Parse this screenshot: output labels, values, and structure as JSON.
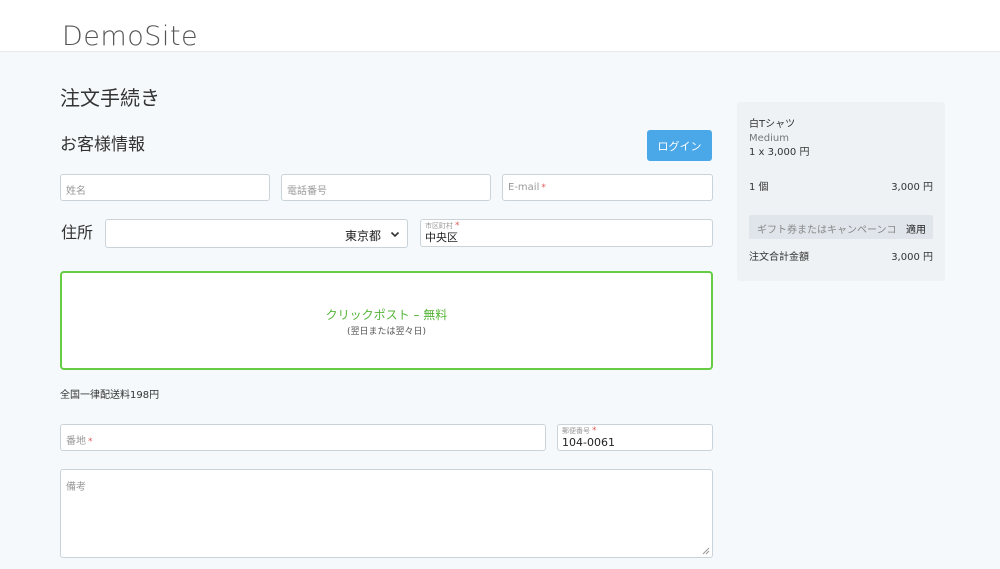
{
  "header": {
    "logo": "DemoSite"
  },
  "page": {
    "title": "注文手続き"
  },
  "customer": {
    "section_title": "お客様情報",
    "login_label": "ログイン",
    "name_placeholder": "姓名",
    "phone_placeholder": "電話番号",
    "email_placeholder": "E-mail",
    "required_mark": "*"
  },
  "address": {
    "label": "住所",
    "prefecture_value": "東京都",
    "city_label": "市区町村",
    "city_value": "中央区",
    "street_placeholder": "番地",
    "postal_label": "郵便番号",
    "postal_value": "104-0061",
    "notes_placeholder": "備考"
  },
  "shipping": {
    "option_name": "クリックポスト – 無料",
    "option_sub": "(翌日または翌々日)",
    "note": "全国一律配送料198円"
  },
  "summary": {
    "item_name": "白Tシャツ",
    "item_variant": "Medium",
    "item_qty_price": "1 x 3,000 円",
    "count_label": "1 個",
    "count_value": "3,000 円",
    "coupon_placeholder": "ギフト券またはキャンペーンコード",
    "apply_label": "適用",
    "total_label": "注文合計金額",
    "total_value": "3,000 円"
  },
  "colors": {
    "accent": "#4aa8e8",
    "selected_border": "#66cc44",
    "required": "#e05a5a"
  },
  "icons": {
    "select": "chevron-down-icon",
    "textarea": "resize-handle-icon"
  }
}
